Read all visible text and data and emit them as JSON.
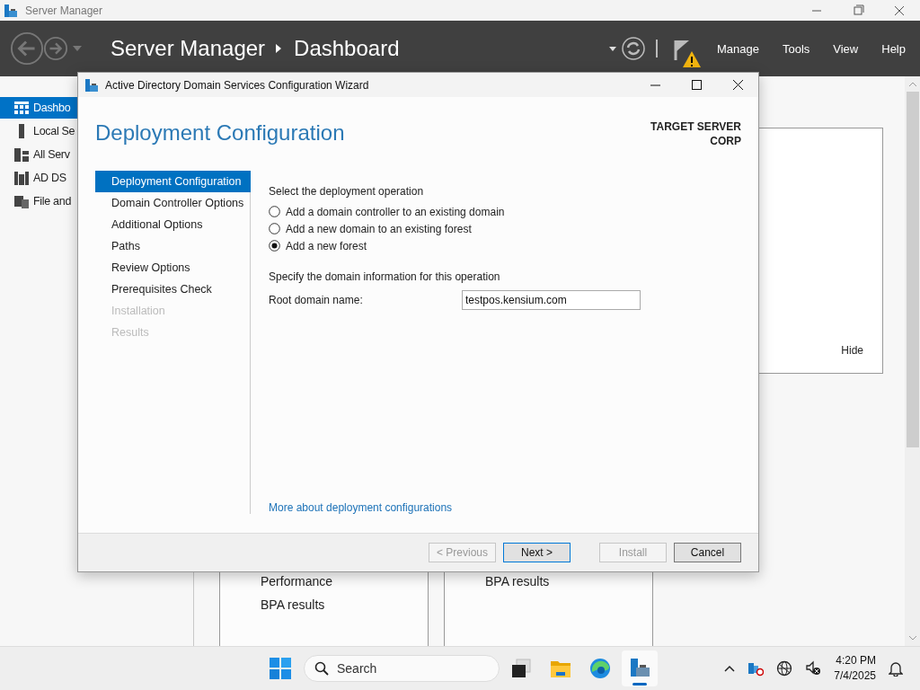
{
  "app_window": {
    "title": "Server Manager",
    "breadcrumb": [
      "Server Manager",
      "Dashboard"
    ],
    "menu": [
      "Manage",
      "Tools",
      "View",
      "Help"
    ]
  },
  "sidebar": {
    "items": [
      {
        "label": "Dashbo",
        "kind": "dashboard",
        "selected": true
      },
      {
        "label": "Local Se",
        "kind": "server",
        "selected": false
      },
      {
        "label": "All Serv",
        "kind": "servers",
        "selected": false
      },
      {
        "label": "AD DS",
        "kind": "role",
        "selected": false
      },
      {
        "label": "File and",
        "kind": "files",
        "selected": false
      }
    ]
  },
  "welcome_panel": {
    "hide_link": "Hide"
  },
  "tiles": [
    {
      "items": [
        "Performance",
        "BPA results"
      ]
    },
    {
      "items": [
        "BPA results"
      ]
    }
  ],
  "wizard": {
    "title": "Active Directory Domain Services Configuration Wizard",
    "heading": "Deployment Configuration",
    "target_server": [
      "TARGET SERVER",
      "CORP"
    ],
    "steps": [
      {
        "label": "Deployment Configuration",
        "selected": true,
        "disabled": false
      },
      {
        "label": "Domain Controller Options",
        "selected": false,
        "disabled": false
      },
      {
        "label": "Additional Options",
        "selected": false,
        "disabled": false
      },
      {
        "label": "Paths",
        "selected": false,
        "disabled": false
      },
      {
        "label": "Review Options",
        "selected": false,
        "disabled": false
      },
      {
        "label": "Prerequisites Check",
        "selected": false,
        "disabled": false
      },
      {
        "label": "Installation",
        "selected": false,
        "disabled": true
      },
      {
        "label": "Results",
        "selected": false,
        "disabled": true
      }
    ],
    "operation_prompt": "Select the deployment operation",
    "options": [
      {
        "label": "Add a domain controller to an existing domain",
        "selected": false
      },
      {
        "label": "Add a new domain to an existing forest",
        "selected": false
      },
      {
        "label": "Add a new forest",
        "selected": true
      }
    ],
    "domain_prompt": "Specify the domain information for this operation",
    "root_domain": {
      "label": "Root domain name:",
      "value": "testpos.kensium.com"
    },
    "help_link": "More about deployment configurations",
    "buttons": [
      {
        "label": "< Previous",
        "disabled": true,
        "default": false
      },
      {
        "label": "Next >",
        "disabled": false,
        "default": true
      },
      {
        "label": "Install",
        "disabled": true,
        "default": false
      },
      {
        "label": "Cancel",
        "disabled": false,
        "default": false
      }
    ]
  },
  "taskbar": {
    "search": {
      "placeholder": "Search"
    },
    "apps": [
      {
        "kind": "task-view",
        "active": false
      },
      {
        "kind": "folder",
        "active": false
      },
      {
        "kind": "browser",
        "active": false
      },
      {
        "kind": "server-manager",
        "active": true
      }
    ],
    "clock": {
      "time": "4:20 PM",
      "date": "7/4/2025"
    }
  }
}
